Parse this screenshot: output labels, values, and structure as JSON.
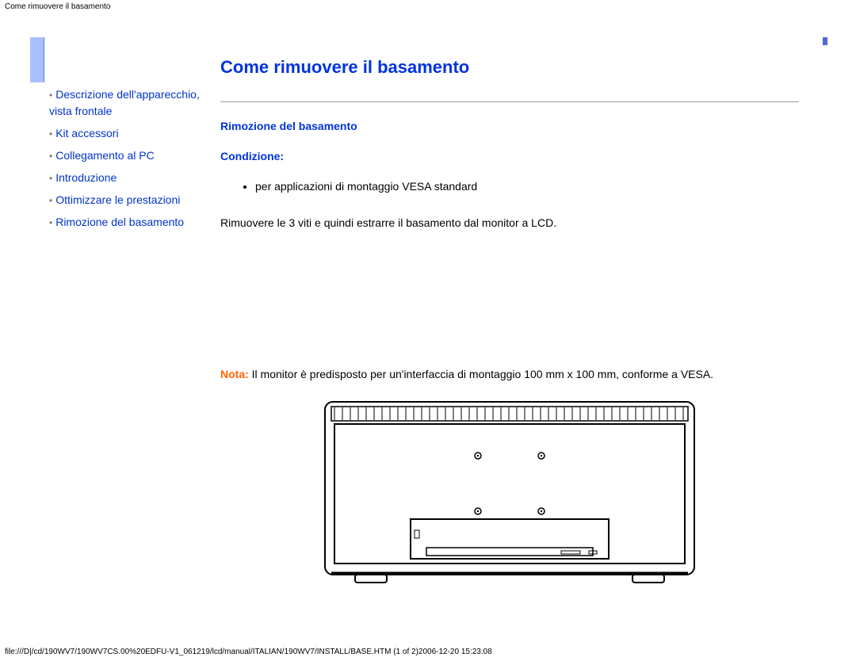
{
  "header_path": "Come rimuovere il basamento",
  "sidebar": {
    "items": [
      {
        "label": "Descrizione dell'apparecchio, vista frontale"
      },
      {
        "label": "Kit accessori"
      },
      {
        "label": "Collegamento al PC"
      },
      {
        "label": "Introduzione"
      },
      {
        "label": "Ottimizzare le prestazioni"
      },
      {
        "label": "Rimozione del basamento"
      }
    ]
  },
  "main": {
    "title": "Come rimuovere il basamento",
    "section_title": "Rimozione del basamento",
    "condition_label": "Condizione:",
    "condition_bullet": "per applicazioni di montaggio VESA standard",
    "step_text": "Rimuovere le 3 viti e quindi estrarre il basamento dal monitor a LCD.",
    "note_label": "Nota:",
    "note_text": " Il monitor è predisposto per un'interfaccia di montaggio 100 mm x 100 mm, conforme a VESA."
  },
  "footer": "file:///D|/cd/190WV7/190WV7CS.00%20EDFU-V1_061219/lcd/manual/ITALIAN/190WV7/INSTALL/BASE.HTM (1 of 2)2006-12-20 15:23:08"
}
